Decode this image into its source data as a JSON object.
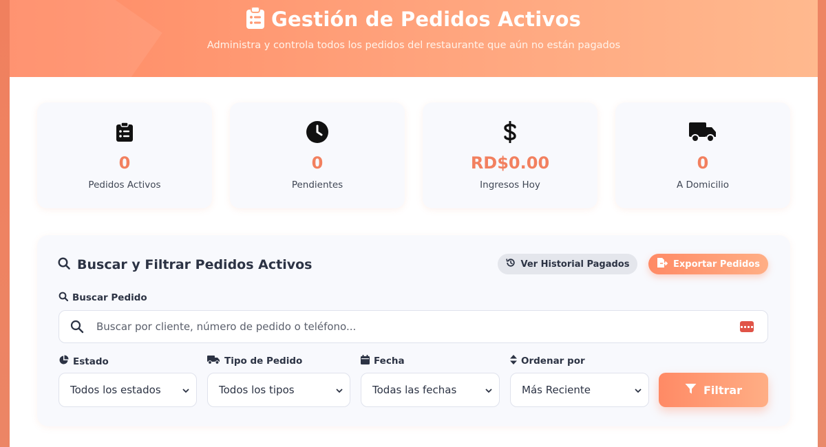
{
  "header": {
    "title": "Gestión de Pedidos Activos",
    "subtitle": "Administra y controla todos los pedidos del restaurante que aún no están pagados",
    "icon": "clipboard-list-icon"
  },
  "stats": [
    {
      "icon": "clipboard-list-icon",
      "value": "0",
      "label": "Pedidos Activos"
    },
    {
      "icon": "clock-icon",
      "value": "0",
      "label": "Pendientes"
    },
    {
      "icon": "dollar-icon",
      "value": "RD$0.00",
      "label": "Ingresos Hoy"
    },
    {
      "icon": "truck-icon",
      "value": "0",
      "label": "A Domicilio"
    }
  ],
  "filters": {
    "title": "Buscar y Filtrar Pedidos Activos",
    "history_button": "Ver Historial Pagados",
    "export_button": "Exportar Pedidos",
    "search_label": "Buscar Pedido",
    "search_placeholder": "Buscar por cliente, número de pedido o teléfono...",
    "estado_label": "Estado",
    "estado_value": "Todos los estados",
    "tipo_label": "Tipo de Pedido",
    "tipo_value": "Todos los tipos",
    "fecha_label": "Fecha",
    "fecha_value": "Todas las fechas",
    "orden_label": "Ordenar por",
    "orden_value": "Más Reciente",
    "filter_button": "Filtrar"
  },
  "colors": {
    "accent": "#ff8a65",
    "value_text": "#f2805f",
    "dark_text": "#2c3344"
  }
}
